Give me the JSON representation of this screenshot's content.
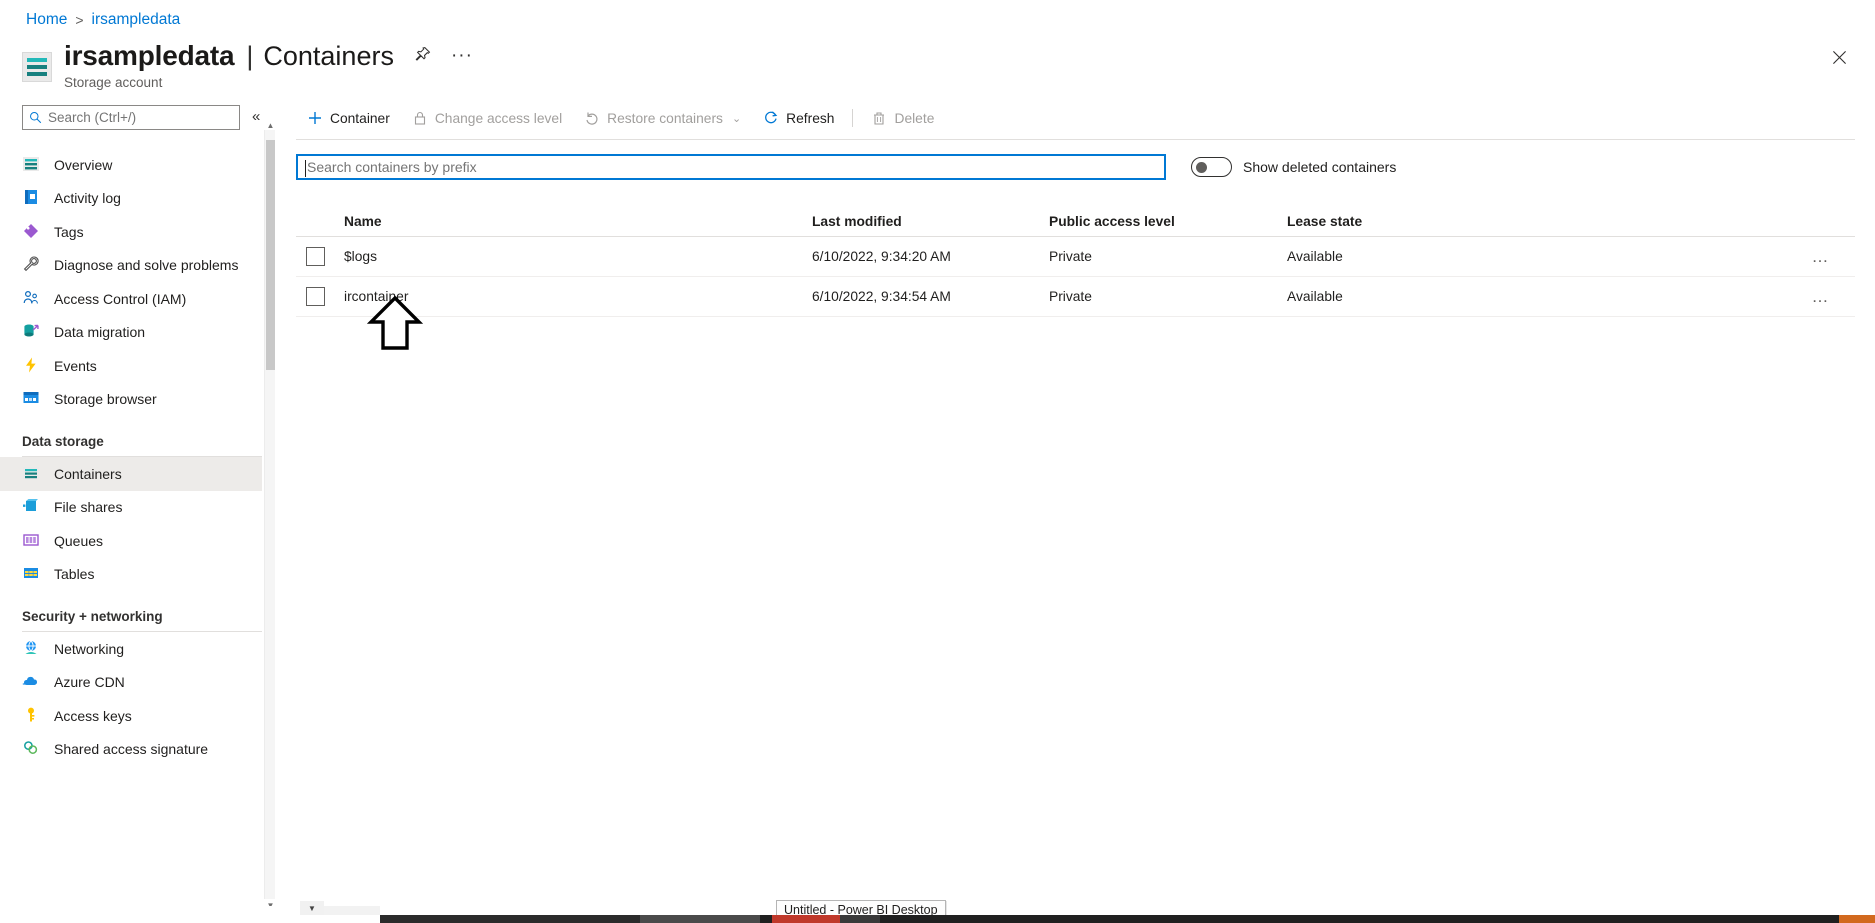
{
  "breadcrumb": {
    "home": "Home",
    "separator": ">",
    "current": "irsampledata"
  },
  "header": {
    "title": "irsampledata",
    "divider": "|",
    "section": "Containers",
    "subtitle": "Storage account",
    "pin_icon": "pin-icon",
    "more_icon": "ellipsis-icon",
    "close_icon": "close-icon"
  },
  "sidebar": {
    "search_placeholder": "Search (Ctrl+/)",
    "search_value": "",
    "collapse_label": "«",
    "items": [
      {
        "label": "Overview",
        "icon": "overview-icon",
        "selected": false
      },
      {
        "label": "Activity log",
        "icon": "activity-log-icon",
        "selected": false
      },
      {
        "label": "Tags",
        "icon": "tags-icon",
        "selected": false
      },
      {
        "label": "Diagnose and solve problems",
        "icon": "wrench-icon",
        "selected": false
      },
      {
        "label": "Access Control (IAM)",
        "icon": "access-control-icon",
        "selected": false
      },
      {
        "label": "Data migration",
        "icon": "data-migration-icon",
        "selected": false
      },
      {
        "label": "Events",
        "icon": "events-icon",
        "selected": false
      },
      {
        "label": "Storage browser",
        "icon": "storage-browser-icon",
        "selected": false
      }
    ],
    "group_data_storage": {
      "label": "Data storage",
      "items": [
        {
          "label": "Containers",
          "icon": "containers-icon",
          "selected": true
        },
        {
          "label": "File shares",
          "icon": "file-shares-icon",
          "selected": false
        },
        {
          "label": "Queues",
          "icon": "queues-icon",
          "selected": false
        },
        {
          "label": "Tables",
          "icon": "tables-icon",
          "selected": false
        }
      ]
    },
    "group_security": {
      "label": "Security + networking",
      "items": [
        {
          "label": "Networking",
          "icon": "networking-icon",
          "selected": false
        },
        {
          "label": "Azure CDN",
          "icon": "cloud-icon",
          "selected": false
        },
        {
          "label": "Access keys",
          "icon": "key-icon",
          "selected": false
        },
        {
          "label": "Shared access signature",
          "icon": "link-icon",
          "selected": false
        }
      ]
    }
  },
  "toolbar": {
    "container_label": "Container",
    "change_access_label": "Change access level",
    "restore_label": "Restore containers",
    "refresh_label": "Refresh",
    "delete_label": "Delete"
  },
  "filters": {
    "prefix_placeholder": "Search containers by prefix",
    "prefix_value": "",
    "show_deleted_label": "Show deleted containers",
    "show_deleted_on": false
  },
  "table": {
    "columns": [
      "Name",
      "Last modified",
      "Public access level",
      "Lease state"
    ],
    "rows": [
      {
        "name": "$logs",
        "last_modified": "6/10/2022, 9:34:20 AM",
        "public_access_level": "Private",
        "lease_state": "Available",
        "menu": "…"
      },
      {
        "name": "ircontainer",
        "last_modified": "6/10/2022, 9:34:54 AM",
        "public_access_level": "Private",
        "lease_state": "Available",
        "menu": "…"
      }
    ]
  },
  "taskbar": {
    "tooltip": "Untitled - Power BI Desktop"
  },
  "colors": {
    "accent": "#0078d4",
    "teal": "#17807f",
    "selected_row_bg": "#edebe9",
    "text": "#201f1e",
    "muted": "#605e5c"
  }
}
